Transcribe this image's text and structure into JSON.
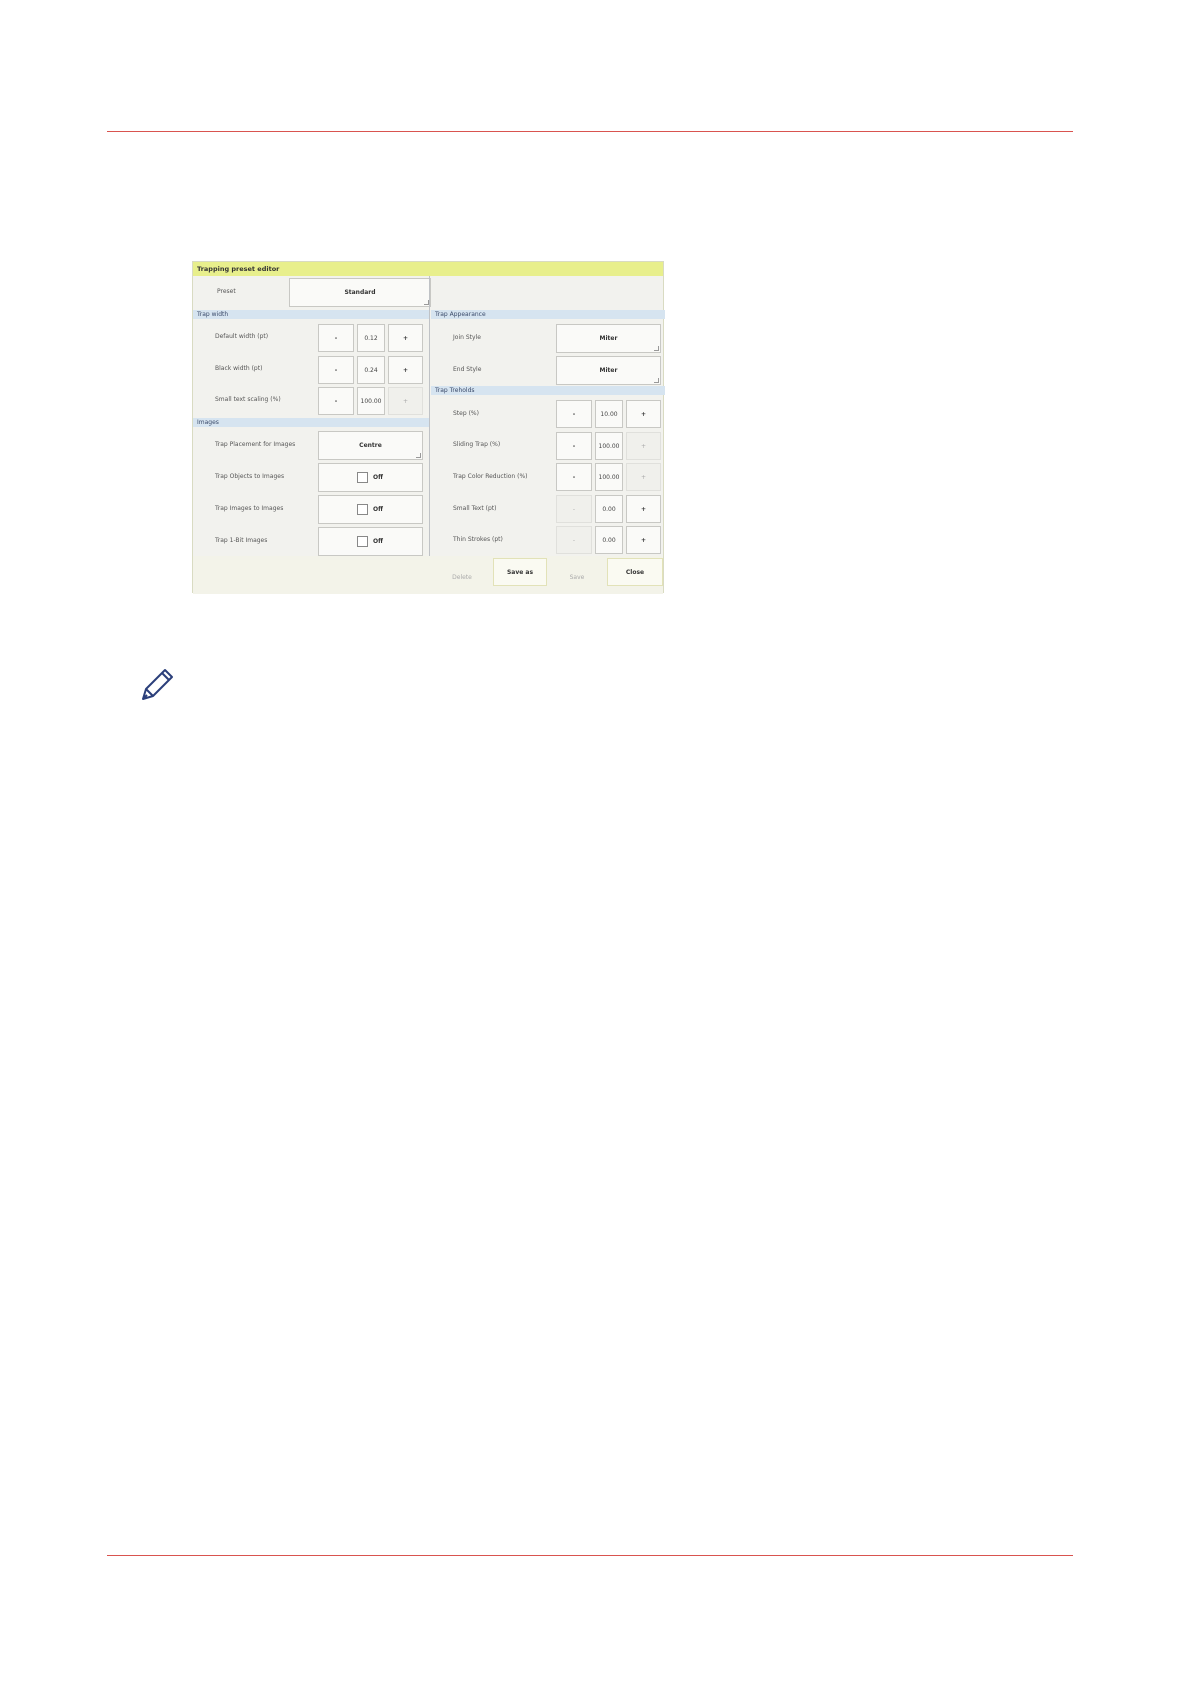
{
  "dialog": {
    "title": "Trapping preset editor",
    "preset": {
      "label": "Preset",
      "value": "Standard"
    },
    "trap_width": {
      "header": "Trap width",
      "default_width": {
        "label": "Default width (pt)",
        "minus": "-",
        "value": "0.12",
        "plus": "+"
      },
      "black_width": {
        "label": "Black width (pt)",
        "minus": "-",
        "value": "0.24",
        "plus": "+"
      },
      "small_text_scaling": {
        "label": "Small text scaling (%)",
        "minus": "-",
        "value": "100.00",
        "plus": "+"
      }
    },
    "images": {
      "header": "Images",
      "placement": {
        "label": "Trap Placement for Images",
        "value": "Centre"
      },
      "objects_to_images": {
        "label": "Trap Objects to Images",
        "state": "Off"
      },
      "images_to_images": {
        "label": "Trap Images to Images",
        "state": "Off"
      },
      "one_bit_images": {
        "label": "Trap 1-Bit Images",
        "state": "Off"
      }
    },
    "trap_appearance": {
      "header": "Trap Appearance",
      "join_style": {
        "label": "Join Style",
        "value": "Miter"
      },
      "end_style": {
        "label": "End Style",
        "value": "Miter"
      }
    },
    "trap_thresholds": {
      "header": "Trap Treholds",
      "step": {
        "label": "Step (%)",
        "minus": "-",
        "value": "10.00",
        "plus": "+"
      },
      "sliding_trap": {
        "label": "Sliding Trap (%)",
        "minus": "-",
        "value": "100.00",
        "plus": "+"
      },
      "color_reduction": {
        "label": "Trap Color Reduction (%)",
        "minus": "-",
        "value": "100.00",
        "plus": "+"
      },
      "small_text": {
        "label": "Small Text (pt)",
        "minus": "-",
        "value": "0.00",
        "plus": "+"
      },
      "thin_strokes": {
        "label": "Thin Strokes (pt)",
        "minus": "-",
        "value": "0.00",
        "plus": "+"
      }
    },
    "footer": {
      "delete": "Delete",
      "save_as": "Save as",
      "save": "Save",
      "close": "Close"
    }
  },
  "icons": {
    "note": "pencil-icon"
  },
  "colors": {
    "rule": "#d9534f",
    "titlebar": "#e8ef8c",
    "section": "#d6e4f0"
  }
}
